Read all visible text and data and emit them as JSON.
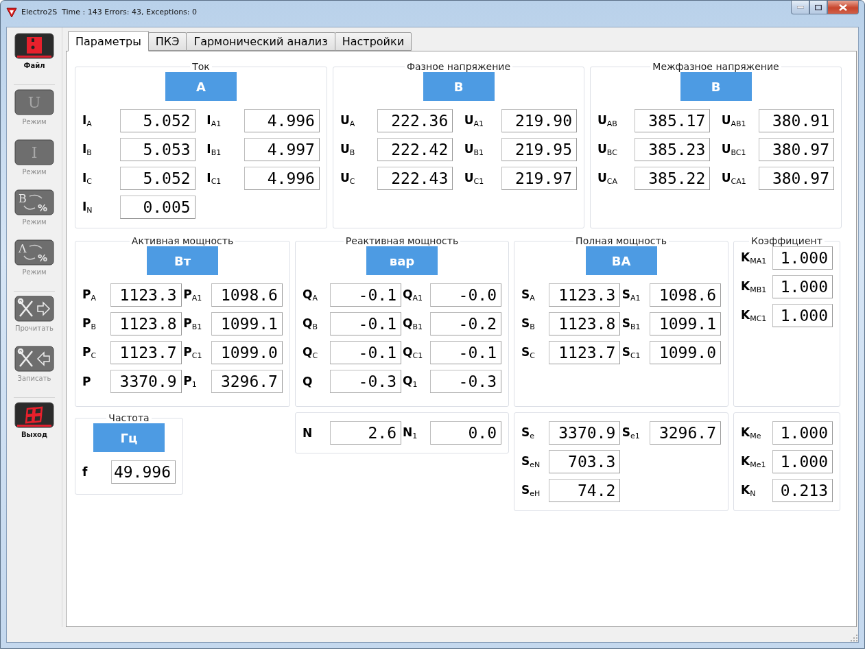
{
  "window": {
    "title": "Electro2S  Time : 143 Errors: 43, Exceptions: 0"
  },
  "sidebar": {
    "groups": [
      [
        {
          "label": "Файл",
          "disabled": false,
          "kind": "floppy"
        }
      ],
      [
        {
          "label": "Режим",
          "disabled": true,
          "kind": "letter",
          "glyph": "U"
        },
        {
          "label": "Режим",
          "disabled": true,
          "kind": "letter",
          "glyph": "I"
        },
        {
          "label": "Режим",
          "disabled": true,
          "kind": "ratio",
          "glyph": "B",
          "glyph2": "%"
        },
        {
          "label": "Режим",
          "disabled": true,
          "kind": "ratio",
          "glyph": "Λ",
          "glyph2": "%"
        }
      ],
      [
        {
          "label": "Прочитать",
          "disabled": true,
          "kind": "read"
        },
        {
          "label": "Записать",
          "disabled": true,
          "kind": "write"
        }
      ],
      [
        {
          "label": "Выход",
          "disabled": false,
          "kind": "exit"
        }
      ]
    ]
  },
  "tabs": [
    {
      "label": "Параметры",
      "selected": true
    },
    {
      "label": "ПКЭ",
      "selected": false
    },
    {
      "label": "Гармонический анализ",
      "selected": false
    },
    {
      "label": "Настройки",
      "selected": false
    }
  ],
  "top_groups": [
    {
      "title": "Ток",
      "unit": "A",
      "rows": [
        [
          {
            "label": "**I**$_{A}$",
            "value": "5.052"
          },
          {
            "label": "**I**$_{A1}$",
            "value": "4.996"
          }
        ],
        [
          {
            "label": "**I**$_{B}$",
            "value": "5.053"
          },
          {
            "label": "**I**$_{B1}$",
            "value": "4.997"
          }
        ],
        [
          {
            "label": "**I**$_{C}$",
            "value": "5.052"
          },
          {
            "label": "**I**$_{C1}$",
            "value": "4.996"
          }
        ],
        [
          {
            "label": "**I**$_{N}$",
            "value": "0.005"
          }
        ]
      ]
    },
    {
      "title": "Фазное напряжение",
      "unit": "В",
      "rows": [
        [
          {
            "label": "**U**$_{A}$",
            "value": "222.36"
          },
          {
            "label": "**U**$_{A1}$",
            "value": "219.90"
          }
        ],
        [
          {
            "label": "**U**$_{B}$",
            "value": "222.42"
          },
          {
            "label": "**U**$_{B1}$",
            "value": "219.95"
          }
        ],
        [
          {
            "label": "**U**$_{C}$",
            "value": "222.43"
          },
          {
            "label": "**U**$_{C1}$",
            "value": "219.97"
          }
        ]
      ]
    },
    {
      "title": "Межфазное напряжение",
      "unit": "В",
      "rows": [
        [
          {
            "label": "**U**$_{AB}$",
            "value": "385.17"
          },
          {
            "label": "**U**$_{AB1}$",
            "value": "380.91"
          }
        ],
        [
          {
            "label": "**U**$_{BC}$",
            "value": "385.23"
          },
          {
            "label": "**U**$_{BC1}$",
            "value": "380.97"
          }
        ],
        [
          {
            "label": "**U**$_{CA}$",
            "value": "385.22"
          },
          {
            "label": "**U**$_{CA1}$",
            "value": "380.97"
          }
        ]
      ]
    }
  ],
  "columns": [
    [
      {
        "title": "Активная мощность",
        "unit": "Вт",
        "rows": [
          [
            {
              "label": "**P**$_{A}$",
              "value": "1123.3"
            },
            {
              "label": "**P**$_{A1}$",
              "value": "1098.6"
            }
          ],
          [
            {
              "label": "**P**$_{B}$",
              "value": "1123.8"
            },
            {
              "label": "**P**$_{B1}$",
              "value": "1099.1"
            }
          ],
          [
            {
              "label": "**P**$_{C}$",
              "value": "1123.7"
            },
            {
              "label": "**P**$_{C1}$",
              "value": "1099.0"
            }
          ],
          [
            {
              "label": "**P**",
              "value": "3370.9"
            },
            {
              "label": "**P**$_{1}$",
              "value": "3296.7"
            }
          ]
        ]
      },
      {
        "title": "Частота",
        "unit": "Гц",
        "rows": [
          [
            {
              "label": "**f**",
              "value": "49.996"
            }
          ]
        ]
      }
    ],
    [
      {
        "title": "Реактивная мощность",
        "unit": "вар",
        "rows": [
          [
            {
              "label": "**Q**$_{A}$",
              "value": "-0.1"
            },
            {
              "label": "**Q**$_{A1}$",
              "value": "-0.0"
            }
          ],
          [
            {
              "label": "**Q**$_{B}$",
              "value": "-0.1"
            },
            {
              "label": "**Q**$_{B1}$",
              "value": "-0.2"
            }
          ],
          [
            {
              "label": "**Q**$_{C}$",
              "value": "-0.1"
            },
            {
              "label": "**Q**$_{C1}$",
              "value": "-0.1"
            }
          ],
          [
            {
              "label": "**Q**",
              "value": "-0.3"
            },
            {
              "label": "**Q**$_{1}$",
              "value": "-0.3"
            }
          ]
        ]
      },
      {
        "rows": [
          [
            {
              "label": "**N**",
              "value": "2.6"
            },
            {
              "label": "**N**$_{1}$",
              "value": "0.0"
            }
          ]
        ]
      }
    ],
    [
      {
        "title": "Полная мощность",
        "unit": "ВА",
        "rows": [
          [
            {
              "label": "**S**$_{A}$",
              "value": "1123.3"
            },
            {
              "label": "**S**$_{A1}$",
              "value": "1098.6"
            }
          ],
          [
            {
              "label": "**S**$_{B}$",
              "value": "1123.8"
            },
            {
              "label": "**S**$_{B1}$",
              "value": "1099.1"
            }
          ],
          [
            {
              "label": "**S**$_{C}$",
              "value": "1123.7"
            },
            {
              "label": "**S**$_{C1}$",
              "value": "1099.0"
            }
          ]
        ]
      },
      {
        "rows": [
          [
            {
              "label": "**S**$_{e}$",
              "value": "3370.9"
            },
            {
              "label": "**S**$_{e1}$",
              "value": "3296.7"
            }
          ],
          [
            {
              "label": "**S**$_{eN}$",
              "value": "703.3"
            }
          ],
          [
            {
              "label": "**S**$_{eH}$",
              "value": "74.2"
            }
          ]
        ]
      }
    ],
    [
      {
        "title": "Коэффициент",
        "rows": [
          [
            {
              "label": "**K**$_{MA1}$",
              "value": "1.000"
            }
          ],
          [
            {
              "label": "**K**$_{MB1}$",
              "value": "1.000"
            }
          ],
          [
            {
              "label": "**K**$_{MC1}$",
              "value": "1.000"
            }
          ]
        ]
      },
      {
        "rows": [
          [
            {
              "label": "**K**$_{Me}$",
              "value": "1.000"
            }
          ],
          [
            {
              "label": "**K**$_{Me1}$",
              "value": "1.000"
            }
          ],
          [
            {
              "label": "**K**$_{N}$",
              "value": "0.213"
            }
          ]
        ]
      }
    ]
  ]
}
